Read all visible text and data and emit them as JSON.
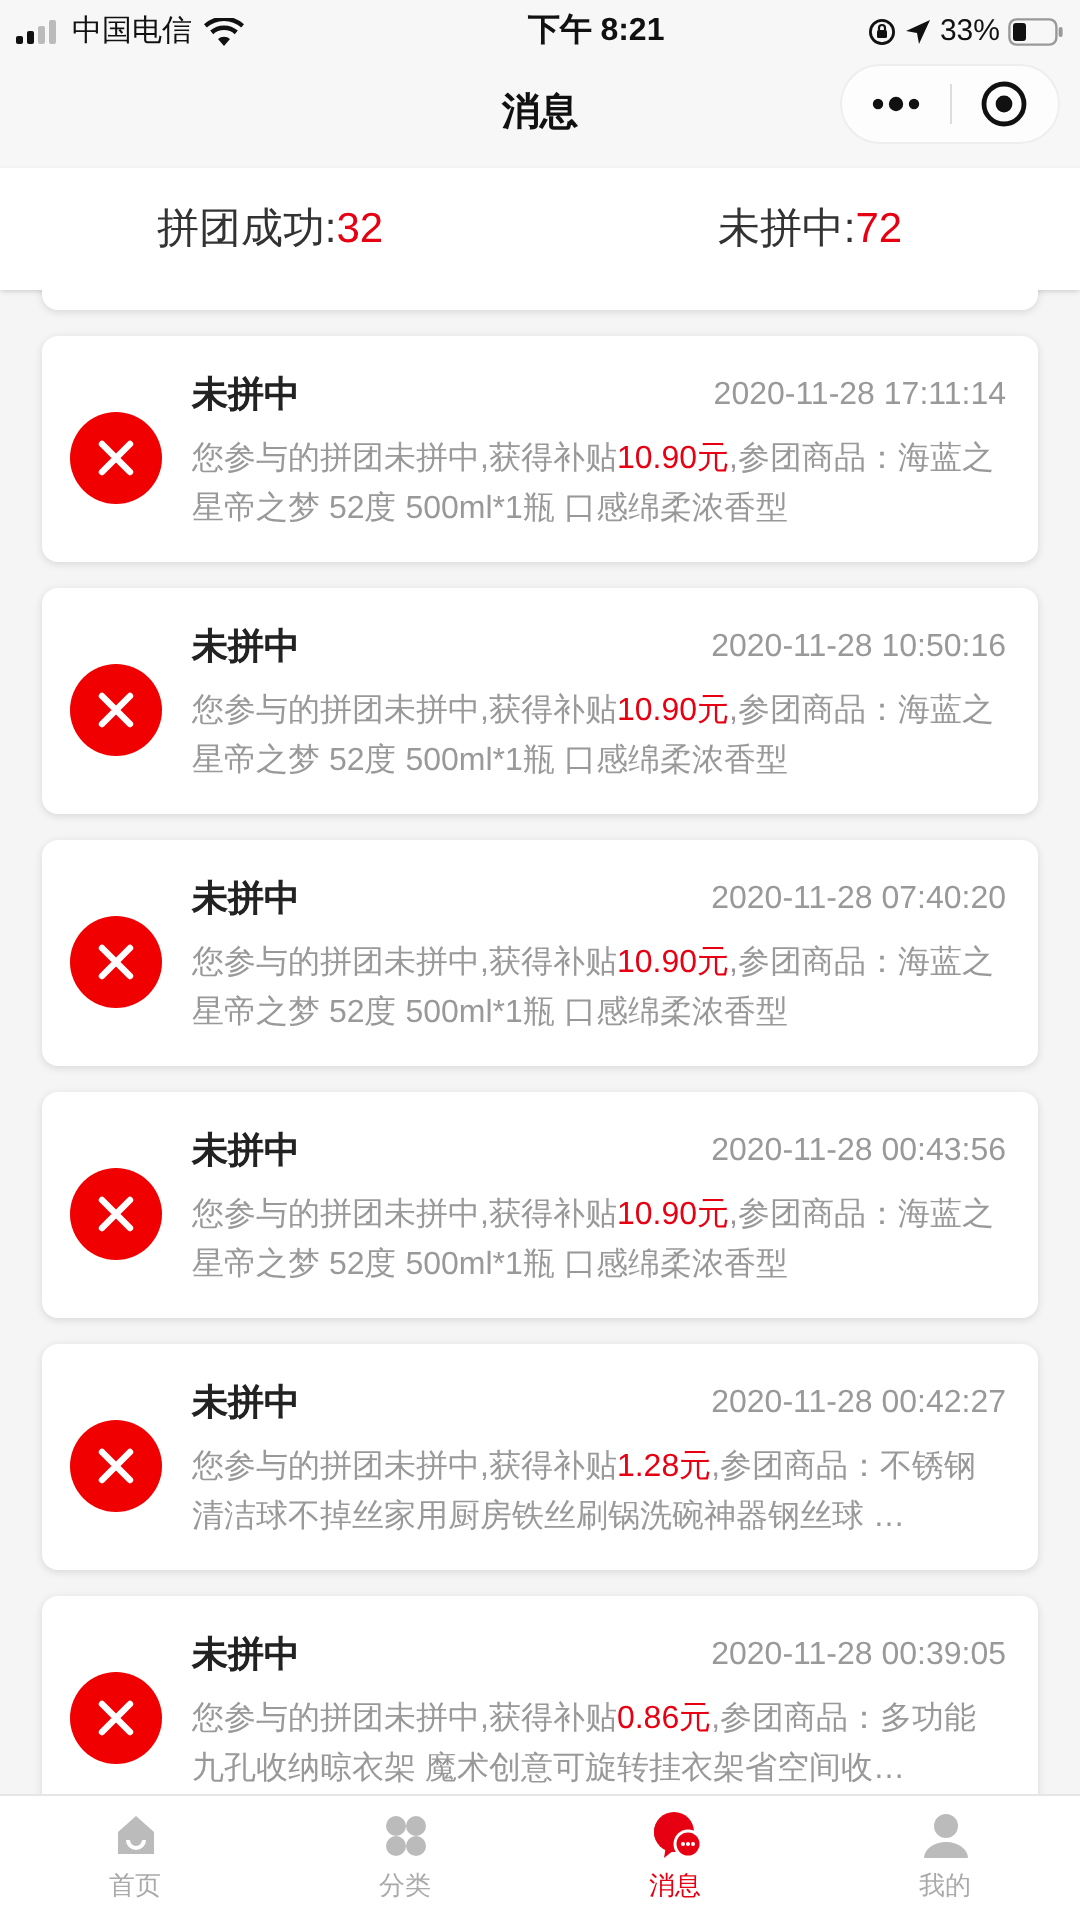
{
  "status_bar": {
    "carrier": "中国电信",
    "time": "下午 8:21",
    "battery": "33%"
  },
  "nav": {
    "title": "消息"
  },
  "summary": [
    {
      "label": "拼团成功:",
      "count": "32"
    },
    {
      "label": "未拼中:",
      "count": "72"
    }
  ],
  "messages": [
    {
      "title": "未拼中",
      "time": "2020-11-28 17:11:14",
      "text_before": "您参与的拼团未拼中,获得补贴",
      "amount": "10.90元",
      "text_after": ",参团商品：海蓝之星帝之梦 52度 500ml*1瓶 口感绵柔浓香型"
    },
    {
      "title": "未拼中",
      "time": "2020-11-28 10:50:16",
      "text_before": "您参与的拼团未拼中,获得补贴",
      "amount": "10.90元",
      "text_after": ",参团商品：海蓝之星帝之梦 52度 500ml*1瓶 口感绵柔浓香型"
    },
    {
      "title": "未拼中",
      "time": "2020-11-28 07:40:20",
      "text_before": "您参与的拼团未拼中,获得补贴",
      "amount": "10.90元",
      "text_after": ",参团商品：海蓝之星帝之梦 52度 500ml*1瓶 口感绵柔浓香型"
    },
    {
      "title": "未拼中",
      "time": "2020-11-28 00:43:56",
      "text_before": "您参与的拼团未拼中,获得补贴",
      "amount": "10.90元",
      "text_after": ",参团商品：海蓝之星帝之梦 52度 500ml*1瓶 口感绵柔浓香型"
    },
    {
      "title": "未拼中",
      "time": "2020-11-28 00:42:27",
      "text_before": "您参与的拼团未拼中,获得补贴",
      "amount": "1.28元",
      "text_after": ",参团商品：不锈钢清洁球不掉丝家用厨房铁丝刷锅洗碗神器钢丝球 …"
    },
    {
      "title": "未拼中",
      "time": "2020-11-28 00:39:05",
      "text_before": "您参与的拼团未拼中,获得补贴",
      "amount": "0.86元",
      "text_after": ",参团商品：多功能九孔收纳晾衣架 魔术创意可旋转挂衣架省空间收…"
    }
  ],
  "tab_bar": [
    {
      "kind": "home",
      "label": "首页",
      "selected": false
    },
    {
      "kind": "category",
      "label": "分类",
      "selected": false
    },
    {
      "kind": "message",
      "label": "消息",
      "selected": true
    },
    {
      "kind": "profile",
      "label": "我的",
      "selected": false
    }
  ]
}
